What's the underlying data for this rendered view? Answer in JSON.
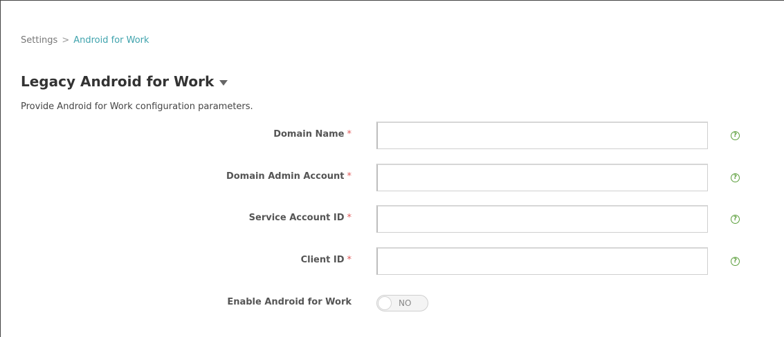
{
  "breadcrumb": {
    "root": "Settings",
    "separator": ">",
    "current": "Android for Work"
  },
  "page": {
    "title": "Legacy Android for Work",
    "description": "Provide Android for Work configuration parameters."
  },
  "form": {
    "required_marker": "*",
    "fields": [
      {
        "label": "Domain Name",
        "value": "",
        "required": true
      },
      {
        "label": "Domain Admin Account",
        "value": "",
        "required": true
      },
      {
        "label": "Service Account ID",
        "value": "",
        "required": true
      },
      {
        "label": "Client ID",
        "value": "",
        "required": true
      }
    ],
    "help_glyph": "?",
    "toggle": {
      "label": "Enable Android for Work",
      "state_text": "NO",
      "enabled": false
    }
  },
  "colors": {
    "link": "#3fa3ad",
    "required": "#e05a5a",
    "help": "#5a9e3a"
  },
  "icons": {
    "title_caret": "caret-down-icon",
    "help": "help-circle-icon"
  }
}
